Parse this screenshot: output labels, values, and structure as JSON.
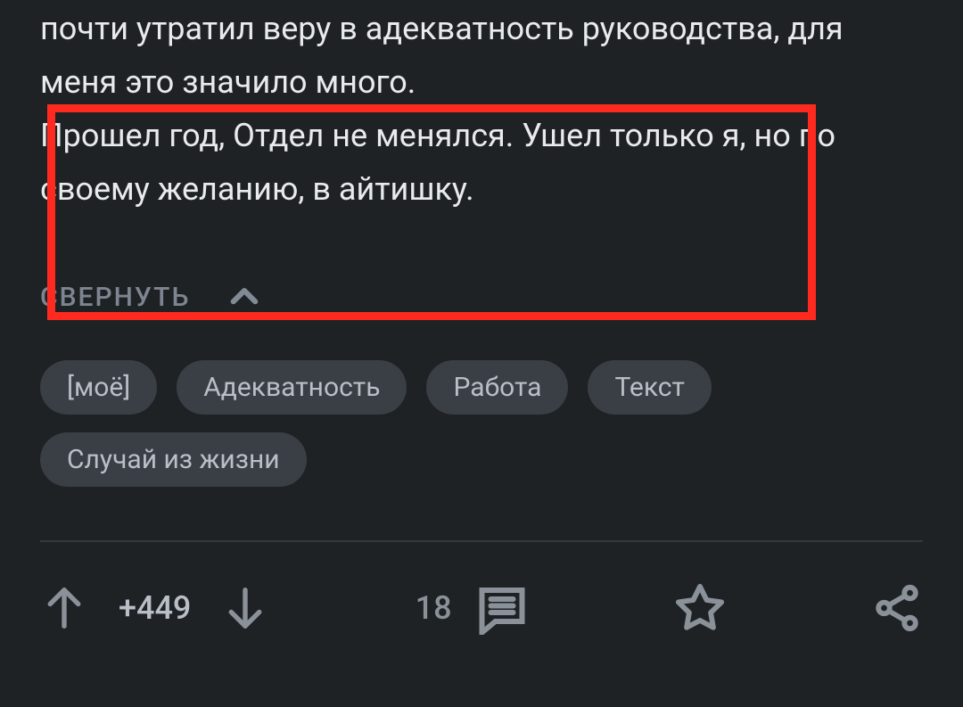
{
  "post": {
    "text_line1": "почти утратил веру в адекватность руководства, для меня это значило много.",
    "text_line2": "Прошел год, Отдел не менялся. Ушел только я, но по своему желанию, в айтишку.",
    "collapse_label": "СВЕРНУТЬ"
  },
  "tags": [
    "[моё]",
    "Адекватность",
    "Работа",
    "Текст",
    "Случай из жизни"
  ],
  "actions": {
    "score": "+449",
    "comments": "18"
  }
}
